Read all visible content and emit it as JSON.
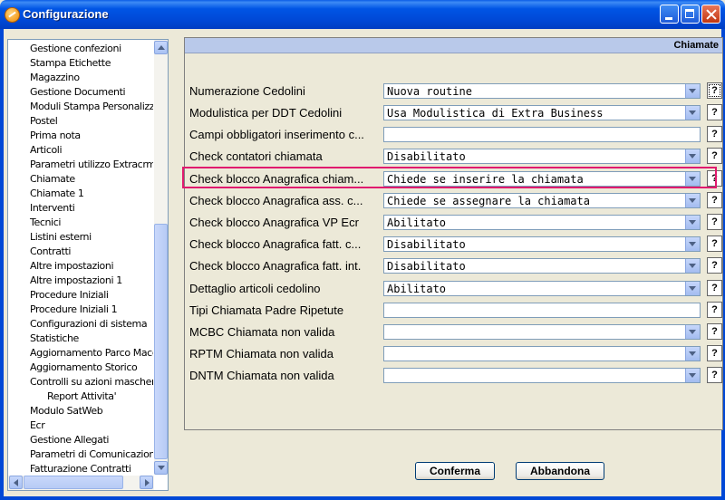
{
  "window": {
    "title": "Configurazione"
  },
  "tree": {
    "items": [
      {
        "label": "Gestione confezioni"
      },
      {
        "label": "Stampa Etichette"
      },
      {
        "label": "Magazzino"
      },
      {
        "label": "Gestione Documenti"
      },
      {
        "label": "Moduli Stampa Personalizzat"
      },
      {
        "label": "Postel"
      },
      {
        "label": "Prima nota"
      },
      {
        "label": "Articoli"
      },
      {
        "label": "Parametri utilizzo Extracrm"
      },
      {
        "label": "Chiamate"
      },
      {
        "label": "Chiamate 1"
      },
      {
        "label": "Interventi"
      },
      {
        "label": "Tecnici"
      },
      {
        "label": "Listini esterni"
      },
      {
        "label": "Contratti"
      },
      {
        "label": "Altre impostazioni"
      },
      {
        "label": "Altre impostazioni 1"
      },
      {
        "label": "Procedure Iniziali"
      },
      {
        "label": "Procedure Iniziali 1"
      },
      {
        "label": "Configurazioni di sistema"
      },
      {
        "label": "Statistiche"
      },
      {
        "label": "Aggiornamento Parco Macch"
      },
      {
        "label": "Aggiornamento Storico"
      },
      {
        "label": "Controlli su azioni maschere"
      },
      {
        "label": "Report Attivita'"
      },
      {
        "label": "Modulo SatWeb"
      },
      {
        "label": "Ecr"
      },
      {
        "label": "Gestione Allegati"
      },
      {
        "label": "Parametri di Comunicazione"
      },
      {
        "label": "Fatturazione Contratti"
      }
    ]
  },
  "panel": {
    "header": "Chiamate",
    "rows": [
      {
        "label": "Numerazione Cedolini",
        "value": "Nuova routine",
        "kind": "dropdown"
      },
      {
        "label": "Modulistica per DDT Cedolini",
        "value": "Usa Modulistica di Extra Business",
        "kind": "dropdown"
      },
      {
        "label": "Campi obbligatori inserimento c...",
        "value": "",
        "kind": "text"
      },
      {
        "label": "Check contatori chiamata",
        "value": "Disabilitato",
        "kind": "dropdown"
      },
      {
        "label": "Check blocco Anagrafica chiam...",
        "value": "Chiede se inserire la chiamata",
        "kind": "dropdown"
      },
      {
        "label": "Check blocco Anagrafica ass. c...",
        "value": "Chiede se assegnare la chiamata",
        "kind": "dropdown"
      },
      {
        "label": "Check blocco Anagrafica VP Ecr",
        "value": "Abilitato",
        "kind": "dropdown"
      },
      {
        "label": "Check blocco Anagrafica fatt. c...",
        "value": "Disabilitato",
        "kind": "dropdown"
      },
      {
        "label": "Check blocco Anagrafica fatt. int.",
        "value": "Disabilitato",
        "kind": "dropdown"
      },
      {
        "label": "Dettaglio articoli cedolino",
        "value": "Abilitato",
        "kind": "dropdown"
      },
      {
        "label": "Tipi Chiamata Padre Ripetute",
        "value": "",
        "kind": "text"
      },
      {
        "label": "MCBC Chiamata non valida",
        "value": "",
        "kind": "dropdown"
      },
      {
        "label": "RPTM Chiamata non valida",
        "value": "",
        "kind": "dropdown"
      },
      {
        "label": "DNTM Chiamata non valida",
        "value": "",
        "kind": "dropdown"
      }
    ],
    "help_label": "?"
  },
  "buttons": {
    "confirm": "Conferma",
    "cancel": "Abbandona"
  }
}
